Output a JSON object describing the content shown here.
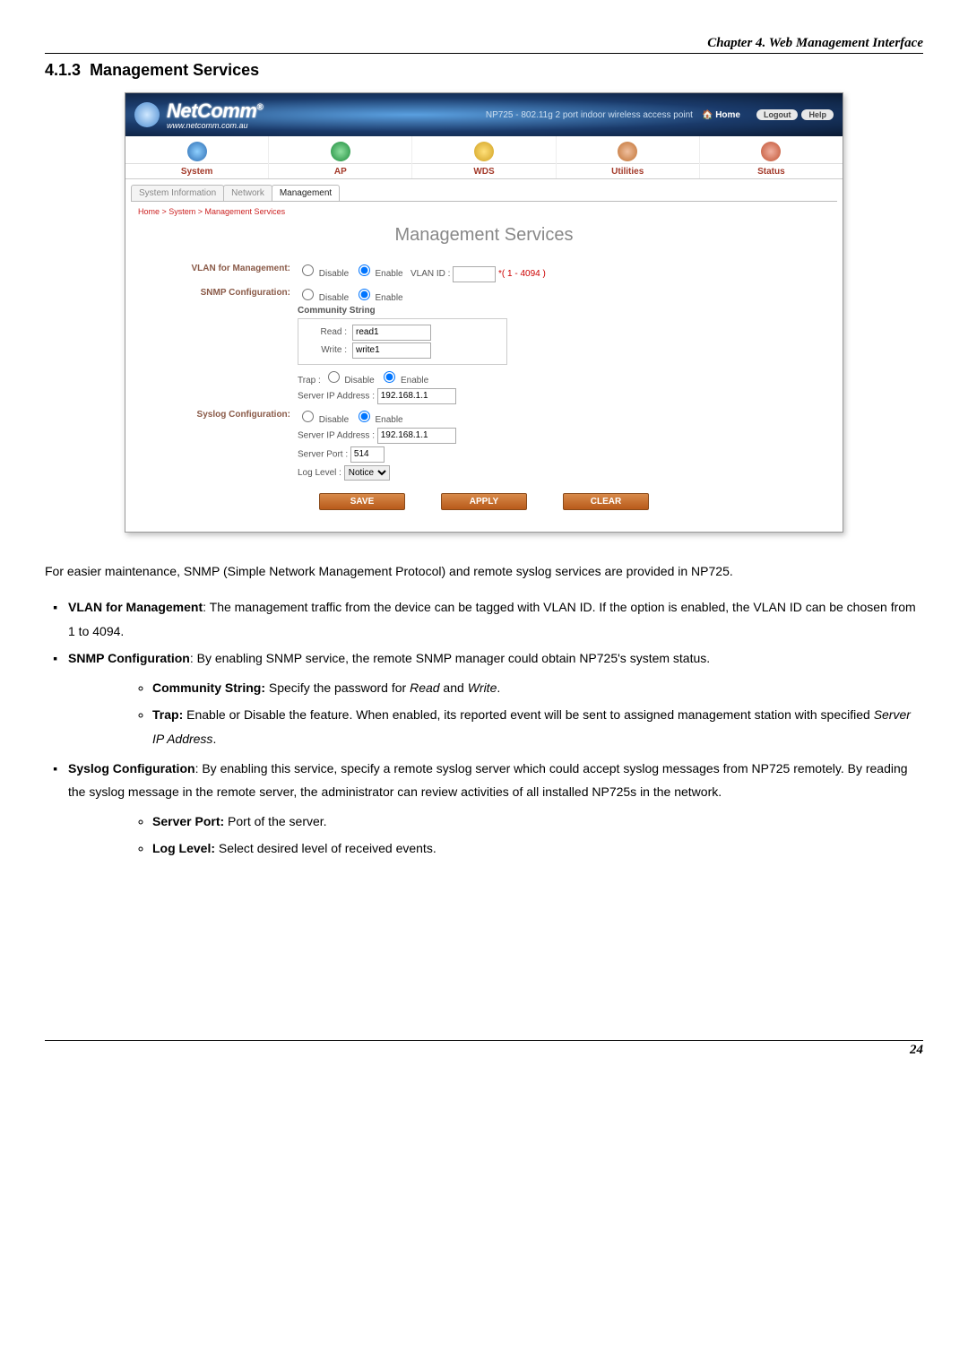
{
  "doc": {
    "chapter": "Chapter 4. Web Management Interface",
    "section_number": "4.1.3",
    "section_title": "Management Services",
    "page_number": "24"
  },
  "ss": {
    "brand": "NetComm",
    "reg": "®",
    "brand_url": "www.netcomm.com.au",
    "product": "NP725 - 802.11g 2 port indoor wireless access point",
    "home": "Home",
    "logout": "Logout",
    "help": "Help",
    "nav": {
      "system": "System",
      "ap": "AP",
      "wds": "WDS",
      "utilities": "Utilities",
      "status": "Status"
    },
    "tabs": {
      "sysinfo": "System Information",
      "network": "Network",
      "mgmt": "Management"
    },
    "breadcrumb": "Home > System > Management Services",
    "page_heading": "Management Services",
    "labels": {
      "vlan_mgmt": "VLAN for Management:",
      "snmp": "SNMP Configuration:",
      "syslog": "Syslog Configuration:",
      "disable": "Disable",
      "enable": "Enable",
      "vlan_id": "VLAN ID :",
      "vlan_range": "*( 1 - 4094 )",
      "community_string": "Community String",
      "read": "Read :",
      "write": "Write :",
      "trap": "Trap :",
      "server_ip": "Server IP Address :",
      "server_port": "Server Port :",
      "log_level": "Log Level :"
    },
    "values": {
      "read": "read1",
      "write": "write1",
      "snmp_ip": "192.168.1.1",
      "syslog_ip": "192.168.1.1",
      "syslog_port": "514",
      "log_level": "Notice"
    },
    "buttons": {
      "save": "SAVE",
      "apply": "APPLY",
      "clear": "CLEAR"
    }
  },
  "text": {
    "intro": "For easier maintenance, SNMP (Simple Network Management Protocol) and remote syslog services are provided in NP725.",
    "vlan_b": "VLAN for Management",
    "vlan_t": ": The management traffic from the device can be tagged with VLAN ID. If the option is enabled, the VLAN ID can be chosen from 1 to 4094.",
    "snmp_b": "SNMP Configuration",
    "snmp_t": ": By enabling SNMP service, the remote SNMP manager could obtain NP725's system status.",
    "cs_b": "Community String:",
    "cs_t": " Specify the password for ",
    "cs_read": "Read",
    "cs_and": " and ",
    "cs_write": "Write",
    "cs_dot": ".",
    "trap_b": "Trap:",
    "trap_t1": " Enable or Disable the feature. When enabled, its reported event will be sent to assigned management station with specified ",
    "trap_i": "Server IP Address",
    "trap_dot": ".",
    "sys_b": "Syslog Configuration",
    "sys_t": ": By enabling this service, specify a remote syslog server which could accept syslog messages from NP725 remotely. By reading the syslog message in the remote server, the administrator can review activities of all installed NP725s in the network.",
    "sp_b": "Server Port:",
    "sp_t": " Port of the server.",
    "ll_b": "Log Level:",
    "ll_t": " Select desired level of received events."
  }
}
